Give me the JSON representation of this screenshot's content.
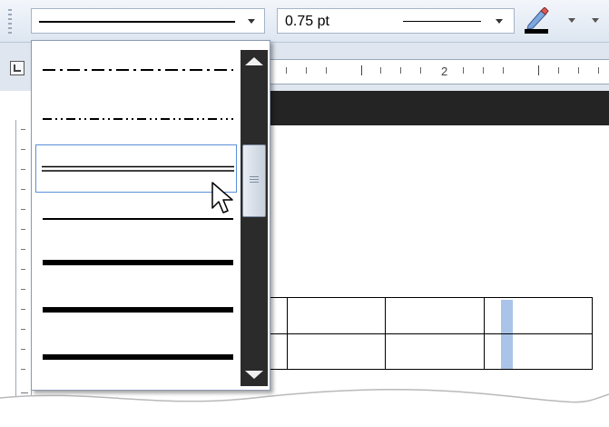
{
  "toolbar": {
    "line_style_value": "solid",
    "line_weight_label": "0.75 pt",
    "pen_color": "#000000"
  },
  "ruler": {
    "number": "2"
  },
  "dropdown": {
    "options": [
      {
        "style": "dash-dot"
      },
      {
        "style": "dash-dot-dot"
      },
      {
        "style": "double",
        "selected": true
      },
      {
        "style": "thin-thick"
      },
      {
        "style": "thick"
      },
      {
        "style": "thick"
      },
      {
        "style": "thick"
      }
    ]
  },
  "colors": {
    "selection_border": "#5a8fd6",
    "table_highlight": "#a9c4e8",
    "scrollbar": "#2b2b2b"
  }
}
